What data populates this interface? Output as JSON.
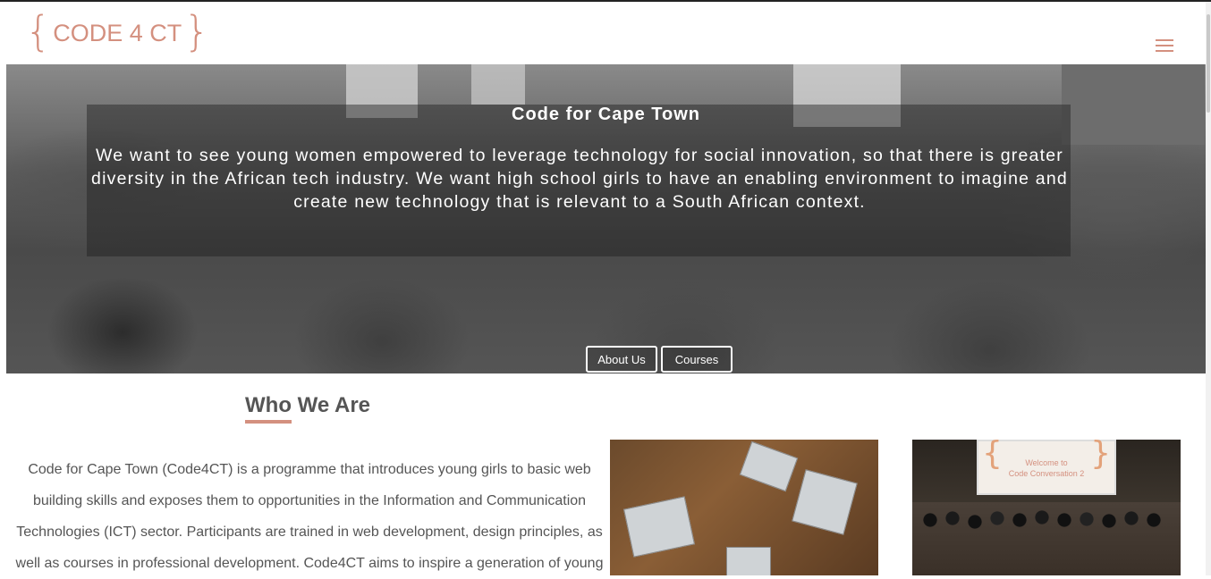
{
  "header": {
    "logo": {
      "left_brace": "{",
      "text": "CODE 4 CT",
      "right_brace": "}"
    },
    "menu_icon": "hamburger-icon"
  },
  "hero": {
    "title": "Code for Cape Town",
    "text": "We want to see young women empowered to leverage technology for social innovation, so that there is greater diversity in the African tech industry. We want high school girls to have an enabling environment to imagine and create new technology that is relevant to a South African context.",
    "buttons": [
      {
        "label": "About Us"
      },
      {
        "label": "Courses"
      }
    ]
  },
  "who": {
    "title": "Who We Are",
    "text": "Code for Cape Town (Code4CT) is a programme that introduces young girls to basic web building skills and exposes them to opportunities in the Information and Communication Technologies (ICT) sector. Participants are trained in web development, design principles, as well as courses in professional development. Code4CT aims to inspire a generation of young"
  },
  "photos": {
    "screen_text_line1": "Welcome to",
    "screen_text_line2": "Code Conversation 2"
  },
  "colors": {
    "accent": "#d4907f",
    "text": "#555555"
  }
}
